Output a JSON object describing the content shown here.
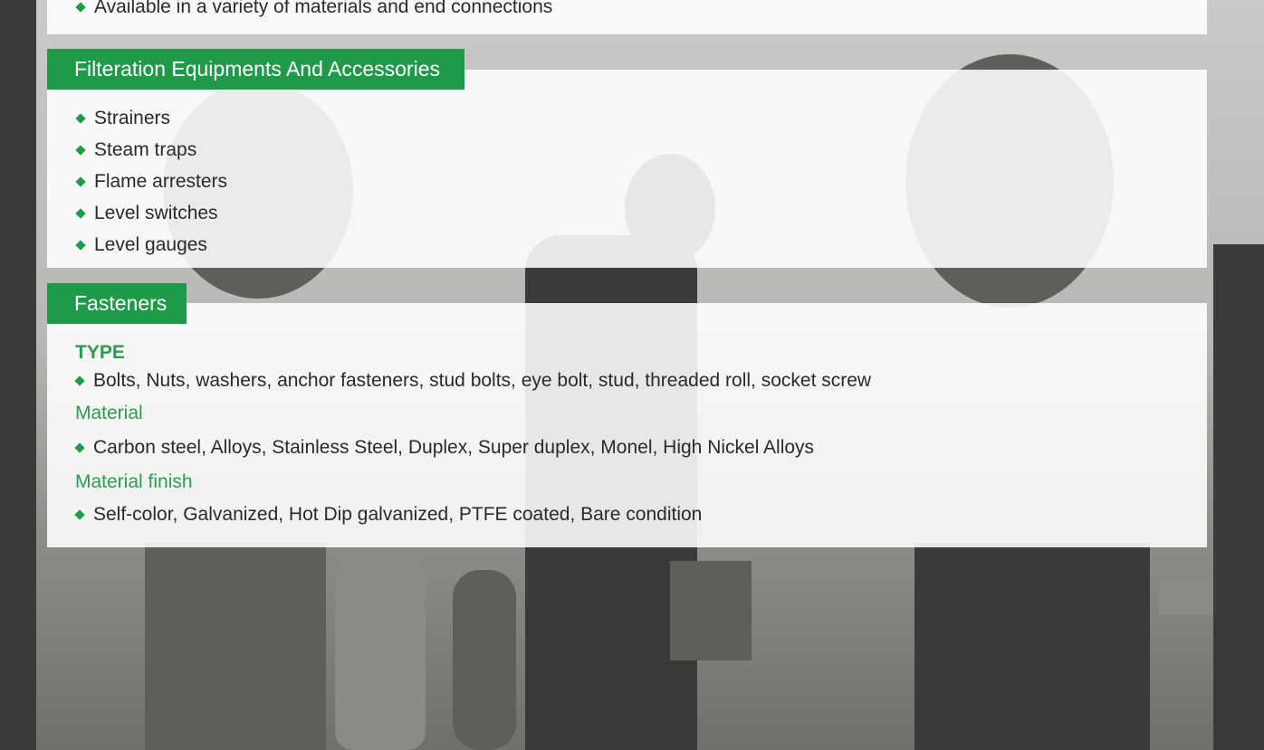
{
  "top_item": "Available in a variety of materials and end connections",
  "filtration": {
    "title": "Filteration Equipments And Accessories",
    "items": [
      "Strainers",
      "Steam traps",
      "Flame arresters",
      "Level switches",
      "Level gauges"
    ]
  },
  "fasteners": {
    "title": "Fasteners",
    "type_heading": "TYPE",
    "type_text": "Bolts, Nuts, washers, anchor fasteners, stud bolts, eye bolt, stud, threaded roll, socket screw",
    "material_heading": "Material",
    "material_text": "Carbon steel, Alloys, Stainless Steel, Duplex, Super duplex, Monel, High Nickel Alloys",
    "finish_heading": "Material finish",
    "finish_text": "Self-color, Galvanized, Hot Dip galvanized, PTFE coated, Bare condition"
  },
  "colors": {
    "accent": "#1f9a48",
    "heading": "#2c9c50",
    "text": "#2a2a2a"
  }
}
